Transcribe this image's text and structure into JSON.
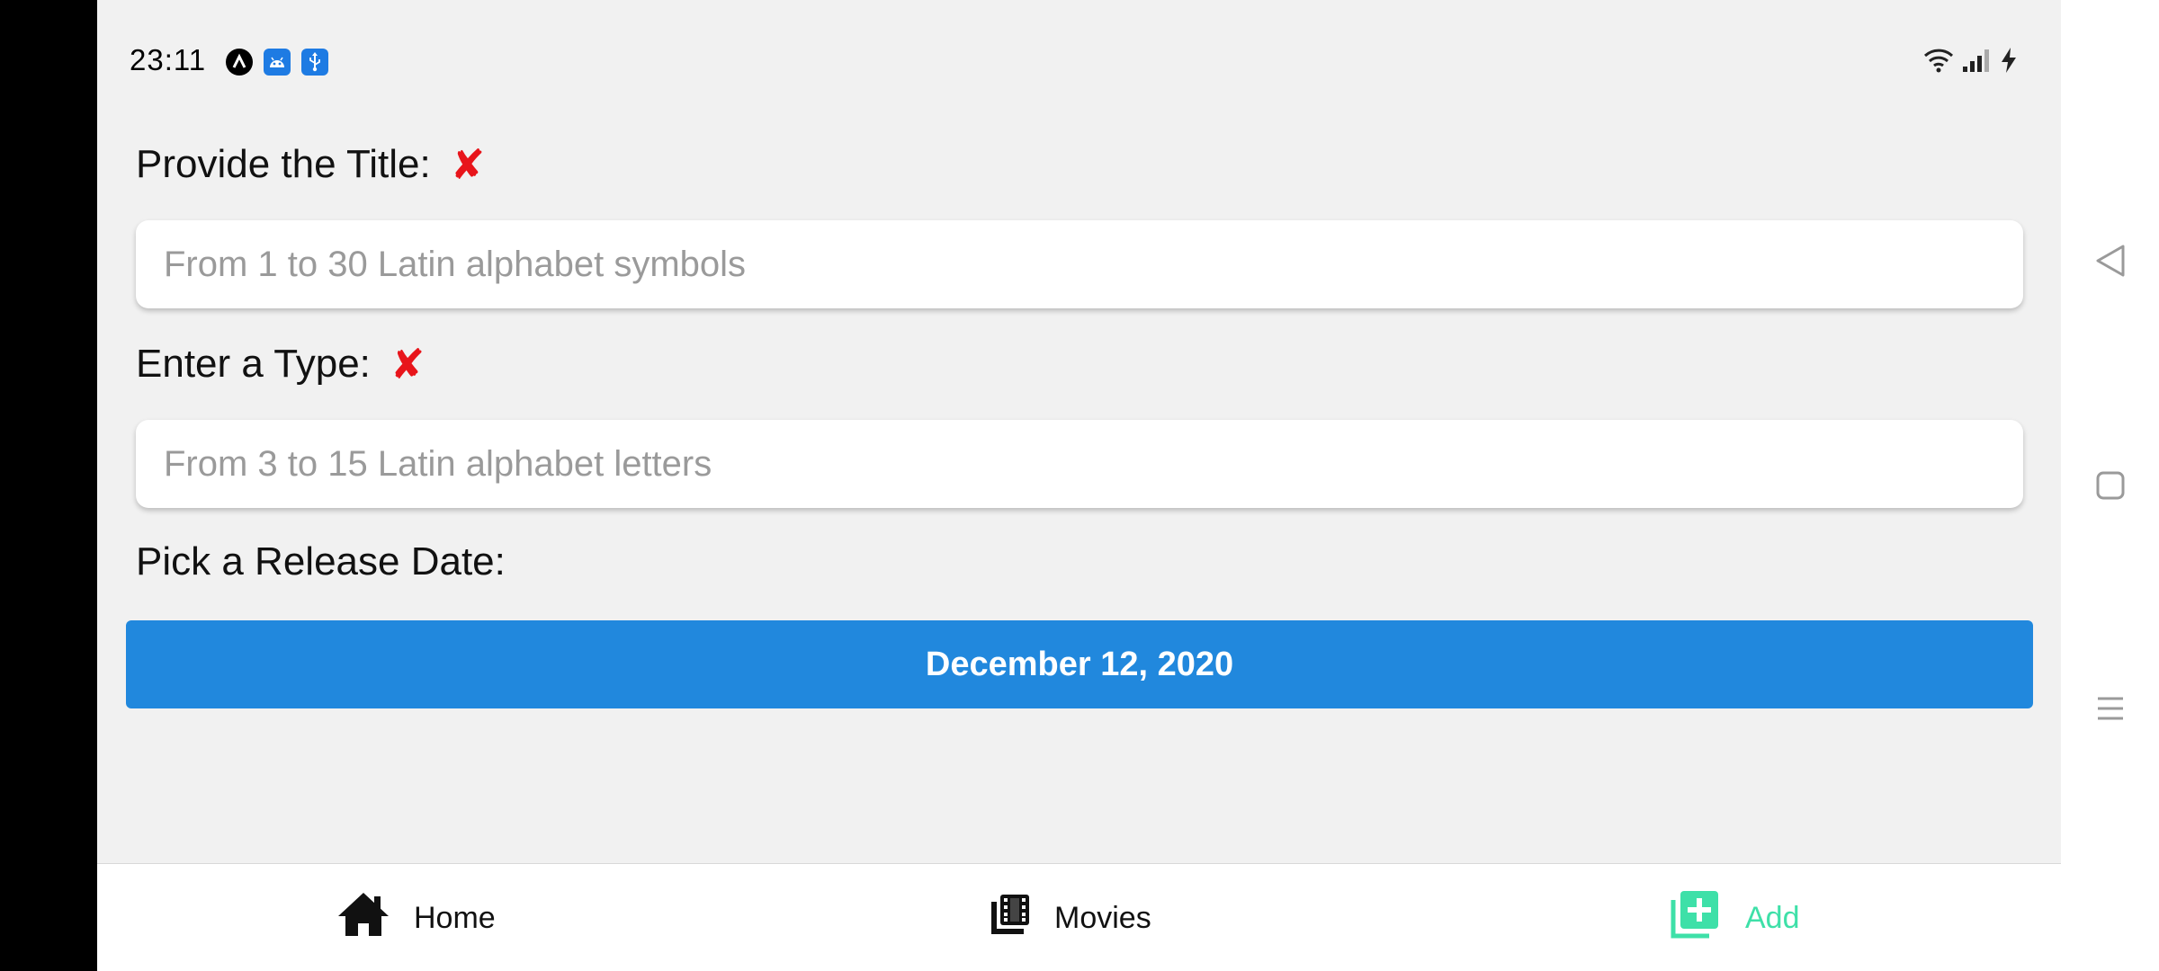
{
  "status_bar": {
    "time": "23:11",
    "icons": [
      "a-notification-icon",
      "android-icon",
      "usb-icon"
    ],
    "right_icons": [
      "wifi-icon",
      "signal-icon",
      "charging-icon"
    ]
  },
  "form": {
    "title": {
      "label": "Provide the Title:",
      "error_mark": "✘",
      "placeholder": "From 1 to 30 Latin alphabet symbols",
      "value": ""
    },
    "type": {
      "label": "Enter a Type:",
      "error_mark": "✘",
      "placeholder": "From 3 to 15 Latin alphabet letters",
      "value": ""
    },
    "release_date": {
      "label": "Pick a Release Date:",
      "button_text": "December 12, 2020"
    }
  },
  "bottom_nav": {
    "items": [
      {
        "label": "Home",
        "icon": "home-icon",
        "active": false
      },
      {
        "label": "Movies",
        "icon": "movies-icon",
        "active": false
      },
      {
        "label": "Add",
        "icon": "add-icon",
        "active": true
      }
    ]
  },
  "colors": {
    "primary": "#2188dd",
    "active_tab": "#3ee0a8",
    "error": "#e8151b",
    "background": "#f1f1f1"
  }
}
